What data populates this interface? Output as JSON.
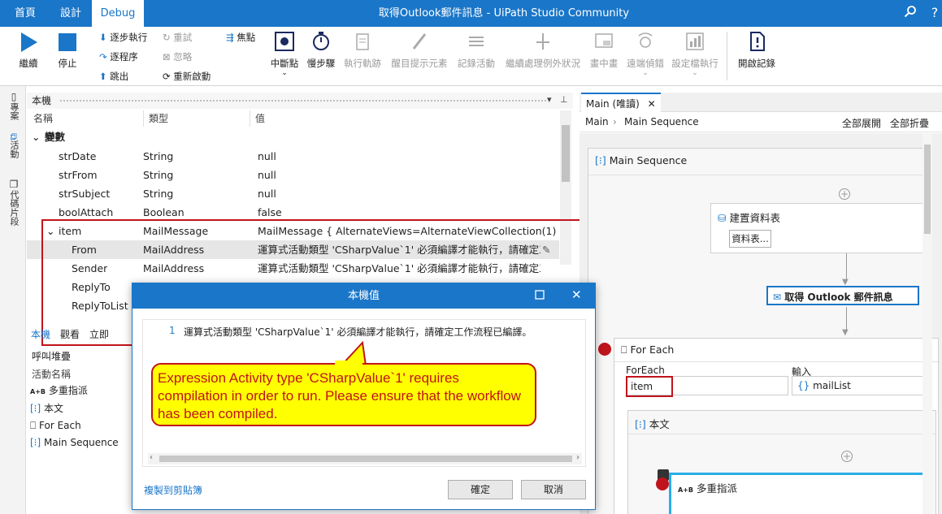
{
  "titlebar": {
    "tabs": [
      "首頁",
      "設計",
      "Debug"
    ],
    "active_tab": "Debug",
    "window_title": "取得Outlook郵件訊息 - UiPath Studio Community"
  },
  "ribbon": {
    "continue": "繼續",
    "stop": "停止",
    "step_into": "逐步執行",
    "step_over": "逐程序",
    "step_out": "跳出",
    "retry": "重試",
    "ignore": "忽略",
    "restart": "重新啟動",
    "focus": "焦點",
    "breakpoints": "中斷點",
    "slow_step": "慢步驟",
    "execution_trail": "執行軌跡",
    "highlight_elements": "醒目提示元素",
    "log_activities": "記錄活動",
    "continue_on_exception": "繼續處理例外狀況",
    "picture_in_picture": "畫中畫",
    "remote_debug": "遠端偵錯",
    "profile_execution": "設定檔執行",
    "open_logs": "開啟記錄"
  },
  "sidebar": {
    "items": [
      "專案",
      "活動",
      "代碼片段"
    ]
  },
  "locals": {
    "title": "本機",
    "columns": [
      "名稱",
      "類型",
      "值"
    ],
    "variables_group": "變數",
    "rows": [
      {
        "name": "strDate",
        "type": "String",
        "value": "null"
      },
      {
        "name": "strFrom",
        "type": "String",
        "value": "null"
      },
      {
        "name": "strSubject",
        "type": "String",
        "value": "null"
      },
      {
        "name": "boolAttach",
        "type": "Boolean",
        "value": "false"
      },
      {
        "name": "item",
        "type": "MailMessage",
        "value": "MailMessage { AlternateViews=AlternateViewCollection(1) {..."
      },
      {
        "name": "From",
        "type": "MailAddress",
        "value": "運算式活動類型 'CSharpValue`1' 必須編譯才能執行，請確定工..."
      },
      {
        "name": "Sender",
        "type": "MailAddress",
        "value": "運算式活動類型 'CSharpValue`1' 必須編譯才能執行，請確定工..."
      },
      {
        "name": "ReplyTo",
        "type": "",
        "value": ""
      },
      {
        "name": "ReplyToList",
        "type": "",
        "value": ""
      }
    ],
    "bottom_tabs": [
      "本機",
      "觀看",
      "立即"
    ]
  },
  "callstack": {
    "title": "呼叫堆疊",
    "column": "活動名稱",
    "items": [
      "多重指派",
      "本文",
      "For Each",
      "Main Sequence"
    ]
  },
  "designer": {
    "tab_label": "Main (唯讀)",
    "breadcrumb": [
      "Main",
      "Main Sequence"
    ],
    "expand_all": "全部展開",
    "collapse_all": "全部折疊",
    "main_sequence": "Main Sequence",
    "build_datatable": "建置資料表",
    "datatable_button": "資料表...",
    "get_outlook": "取得 Outlook 郵件訊息",
    "for_each": "For Each",
    "foreach_label": "ForEach",
    "foreach_value": "item",
    "input_label": "輸入",
    "input_value": "mailList",
    "body": "本文",
    "multiple_assign": "多重指派"
  },
  "dialog": {
    "title": "本機值",
    "line_number": "1",
    "text": "運算式活動類型 'CSharpValue`1' 必須編譯才能執行，請確定工作流程已編譯。",
    "copy_link": "複製到剪貼簿",
    "ok": "確定",
    "cancel": "取消"
  },
  "callout": {
    "text": "Expression Activity type 'CSharpValue`1' requires compilation in order to run. Please ensure that the workflow has been compiled."
  },
  "colors": {
    "brand": "#1a76c8",
    "highlight": "#c0141c",
    "callout_fill": "#ffff00"
  }
}
